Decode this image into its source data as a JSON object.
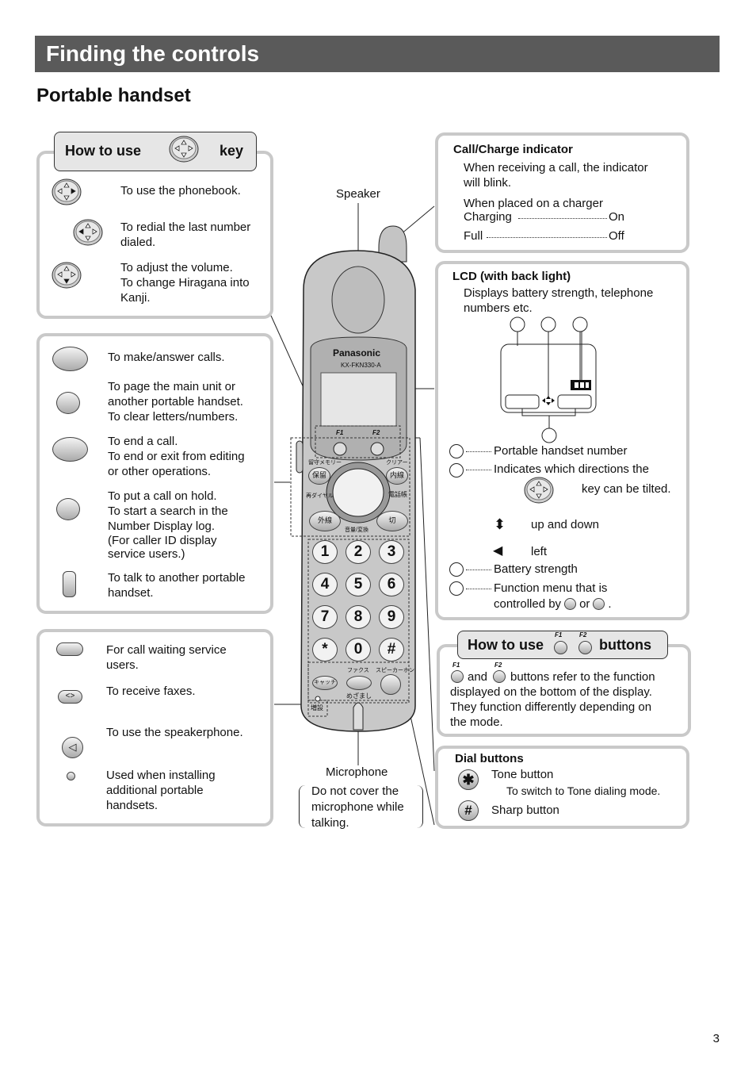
{
  "page": {
    "title": "Finding the controls",
    "subtitle": "Portable handset",
    "page_number": "3"
  },
  "navkey_panel": {
    "header_left": "How to use",
    "header_right": "key",
    "items": [
      {
        "icon": "navkey-right-icon",
        "text1": "To use the phonebook.",
        "text2": ""
      },
      {
        "icon": "navkey-left-icon",
        "text1": "To redial the last number",
        "text2": "dialed."
      },
      {
        "icon": "navkey-down-icon",
        "text1": "To adjust the volume.",
        "text2": "To change Hiragana into",
        "text3": "Kanji."
      }
    ]
  },
  "buttons_panel": {
    "items": [
      {
        "icon": "talk-button-icon",
        "lines": [
          "To make/answer calls."
        ]
      },
      {
        "icon": "intercom-button-icon",
        "lines": [
          "To page the main unit or",
          "another portable handset.",
          "To clear letters/numbers."
        ]
      },
      {
        "icon": "off-button-icon",
        "lines": [
          "To end a call.",
          "To end or exit from editing",
          "or other operations."
        ]
      },
      {
        "icon": "hold-button-icon",
        "lines": [
          "To put a call on hold.",
          "To start a search in the",
          "Number Display log.",
          "(For caller ID display",
          "service users.)"
        ]
      },
      {
        "icon": "side-button-icon",
        "lines": [
          "To talk to another portable",
          "handset."
        ]
      }
    ]
  },
  "misc_panel": {
    "items": [
      {
        "icon": "catch-button-icon",
        "lines": [
          "For call waiting service",
          "users."
        ]
      },
      {
        "icon": "fax-button-icon",
        "lines": [
          "To receive faxes."
        ]
      },
      {
        "icon": "speaker-button-icon",
        "lines": [
          "To use the speakerphone."
        ]
      },
      {
        "icon": "install-hole-icon",
        "lines": [
          "Used when installing",
          "additional portable",
          "handsets."
        ]
      }
    ]
  },
  "handset": {
    "brand": "Panasonic",
    "model": "KX-FKN330-A",
    "f1": "F1",
    "f2": "F2",
    "speaker_label": "Speaker",
    "microphone_label": "Microphone",
    "microphone_note": [
      "Do not cover the",
      "microphone while",
      "talking."
    ],
    "keys": [
      "1",
      "2",
      "3",
      "4",
      "5",
      "6",
      "7",
      "8",
      "9",
      "*",
      "0",
      "#"
    ],
    "jp": {
      "hold": "保留",
      "intercom": "内線",
      "talk": "外線",
      "off": "切",
      "memo": "留守メモリー",
      "clear": "クリアー",
      "redial": "再ダイヤル",
      "phonebook": "電話帳",
      "volume": "音量/変換",
      "catch": "キャッチ",
      "fax": "ファクス",
      "speaker": "スピーカーホン",
      "alarm": "めざまし",
      "add": "増設"
    }
  },
  "indicator_panel": {
    "title": "Call/Charge indicator",
    "desc": [
      "When receiving a call, the indicator",
      "will blink."
    ],
    "charger": "When placed on a charger",
    "rows": [
      {
        "label": "Charging",
        "value": "On"
      },
      {
        "label": "Full",
        "value": "Off"
      }
    ]
  },
  "lcd_panel": {
    "title": "LCD (with back light)",
    "desc": [
      "Displays battery strength, telephone",
      "numbers etc."
    ],
    "legend": [
      {
        "text": "Portable handset number"
      },
      {
        "text": "Indicates which directions the",
        "text2": "key can be tilted."
      },
      {
        "text": "Battery strength"
      },
      {
        "text": "Function menu that is",
        "text2": "controlled by",
        "or": "or",
        "end": "."
      }
    ],
    "updown": "up and down",
    "left": "left"
  },
  "fbuttons_panel": {
    "header_left": "How to use",
    "header_right": "buttons",
    "f1": "F1",
    "f2": "F2",
    "and": "and",
    "lines": [
      "buttons refer to the function",
      "displayed on the bottom of the display.",
      "They function differently depending on",
      "the mode."
    ]
  },
  "dial_panel": {
    "title": "Dial buttons",
    "tone": "Tone button",
    "tone_desc": "To switch to Tone dialing mode.",
    "sharp": "Sharp button"
  }
}
